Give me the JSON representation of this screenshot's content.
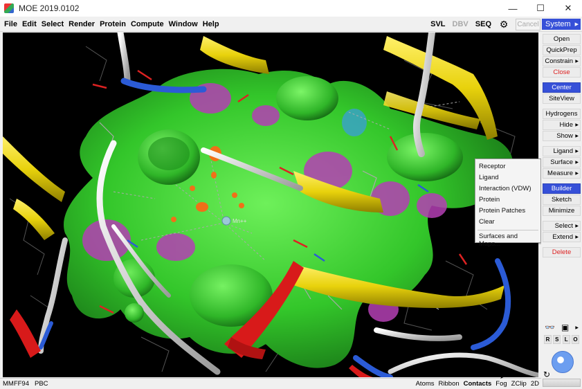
{
  "window": {
    "title": "MOE 2019.0102",
    "minimize_glyph": "—",
    "maximize_glyph": "☐",
    "close_glyph": "✕"
  },
  "menubar": {
    "items": [
      "File",
      "Edit",
      "Select",
      "Render",
      "Protein",
      "Compute",
      "Window",
      "Help"
    ],
    "tools": {
      "svl": "SVL",
      "dbv": "DBV",
      "seq": "SEQ",
      "cancel": "Cancel"
    },
    "system_label": "System"
  },
  "viewport": {
    "atom_label": "Mn++"
  },
  "rightpanel": {
    "buttons": [
      {
        "label": "Open",
        "style": "normal",
        "arrow": false
      },
      {
        "label": "QuickPrep",
        "style": "normal",
        "arrow": false
      },
      {
        "label": "Constrain",
        "style": "normal",
        "arrow": true
      },
      {
        "label": "Close",
        "style": "red",
        "arrow": false
      },
      {
        "label": "Center",
        "style": "blue",
        "arrow": false
      },
      {
        "label": "SiteView",
        "style": "normal",
        "arrow": false
      },
      {
        "label": "Hydrogens",
        "style": "normal",
        "arrow": false
      },
      {
        "label": "Hide",
        "style": "normal",
        "arrow": true
      },
      {
        "label": "Show",
        "style": "normal",
        "arrow": true
      },
      {
        "label": "Ligand",
        "style": "normal",
        "arrow": true
      },
      {
        "label": "Surface",
        "style": "normal",
        "arrow": true
      },
      {
        "label": "Measure",
        "style": "normal",
        "arrow": true
      },
      {
        "label": "Builder",
        "style": "blue",
        "arrow": false
      },
      {
        "label": "Sketch",
        "style": "normal",
        "arrow": false
      },
      {
        "label": "Minimize",
        "style": "normal",
        "arrow": false
      },
      {
        "label": "Select",
        "style": "normal",
        "arrow": true
      },
      {
        "label": "Extend",
        "style": "normal",
        "arrow": true
      },
      {
        "label": "Delete",
        "style": "red",
        "arrow": false
      }
    ],
    "view_keys": [
      "R",
      "S",
      "L",
      "O"
    ]
  },
  "surface_menu": {
    "items": [
      "Receptor",
      "Ligand",
      "Interaction (VDW)",
      "Protein",
      "Protein Patches",
      "Clear",
      "Surfaces and Maps..."
    ]
  },
  "statusbar": {
    "left": [
      "MMFF94",
      "PBC"
    ],
    "right": [
      "Atoms",
      "Ribbon",
      "Contacts",
      "Fog",
      "ZClip",
      "2D"
    ],
    "active": "Contacts"
  }
}
